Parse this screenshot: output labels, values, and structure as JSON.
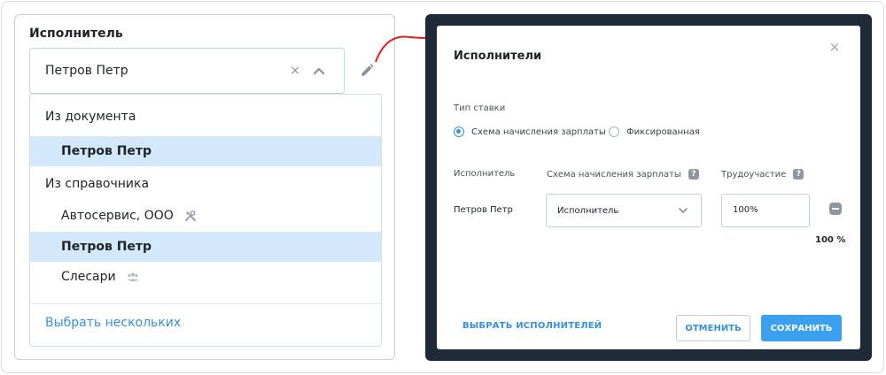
{
  "left": {
    "field_label": "Исполнитель",
    "selected_value": "Петров Петр",
    "clear_glyph": "×",
    "dropdown": {
      "group_document": "Из документа",
      "group_directory": "Из справочника",
      "items": [
        {
          "label": "Петров Петр",
          "selected": true
        },
        {
          "label": "Автосервис, ООО",
          "icon": "tools-icon"
        },
        {
          "label": "Петров Петр",
          "selected": true
        },
        {
          "label": "Слесари",
          "icon": "group-icon"
        }
      ],
      "select_multiple": "Выбрать нескольких"
    }
  },
  "modal": {
    "title": "Исполнители",
    "close_glyph": "×",
    "rate_type_label": "Тип ставки",
    "rate_options": [
      {
        "label": "Схема начисления зарплаты",
        "checked": true
      },
      {
        "label": "Фиксированная",
        "checked": false
      }
    ],
    "columns": {
      "performer": "Исполнитель",
      "scheme": "Схема начисления зарплаты",
      "participation": "Трудоучастие"
    },
    "help_glyph": "?",
    "row": {
      "name": "Петров Петр",
      "scheme_value": "Исполнитель",
      "percent": "100%"
    },
    "total_percent": "100 %",
    "buttons": {
      "select_performers": "ВЫБРАТЬ ИСПОЛНИТЕЛЕЙ",
      "cancel": "ОТМЕНИТЬ",
      "save": "СОХРАНИТЬ"
    }
  },
  "colors": {
    "accent": "#3a8fd9",
    "selected_row": "#d4e8fb",
    "modal_backdrop": "#1f2a38",
    "arrow": "#e02020"
  }
}
